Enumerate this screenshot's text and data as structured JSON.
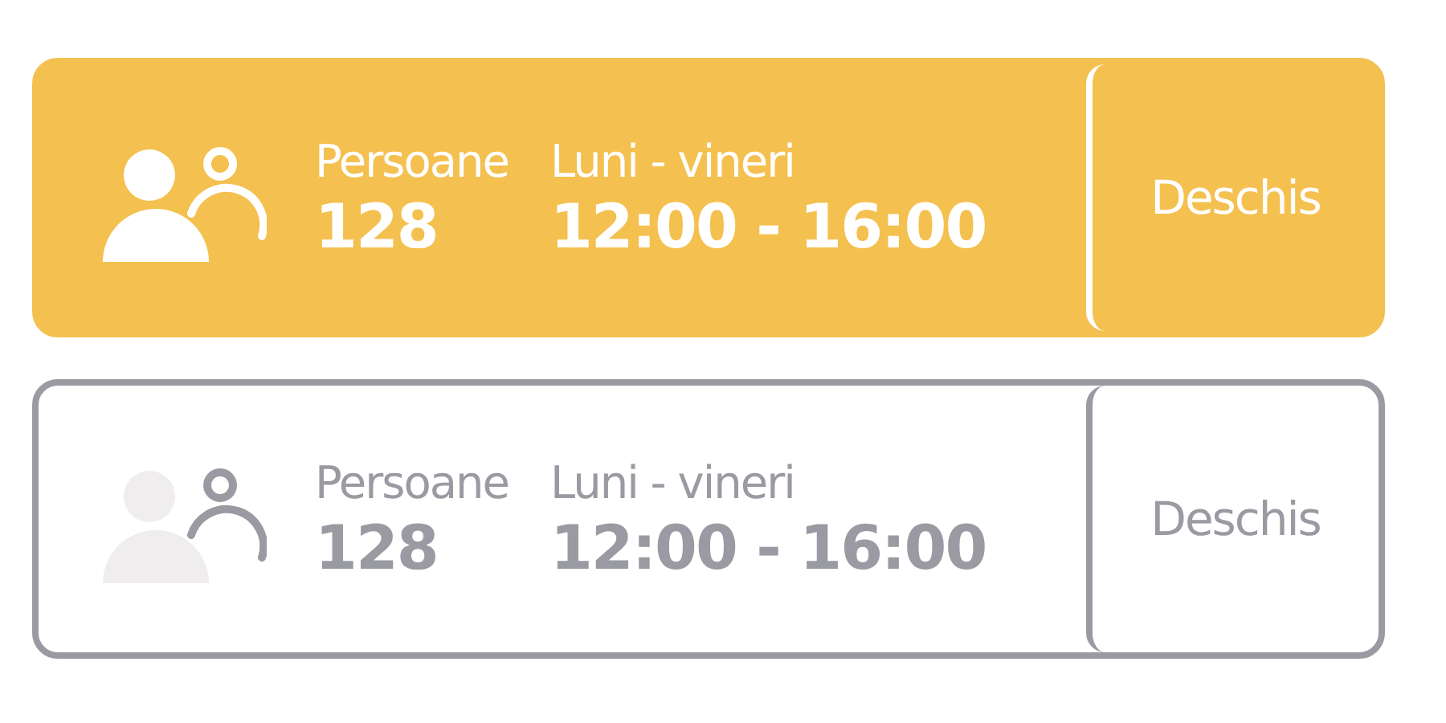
{
  "cards": [
    {
      "selected": true,
      "people_label": "Persoane",
      "people_count": "128",
      "days_label": "Luni - vineri",
      "hours": "12:00 - 16:00",
      "button": "Deschis"
    },
    {
      "selected": false,
      "people_label": "Persoane",
      "people_count": "128",
      "days_label": "Luni - vineri",
      "hours": "12:00 - 16:00",
      "button": "Deschis"
    }
  ]
}
